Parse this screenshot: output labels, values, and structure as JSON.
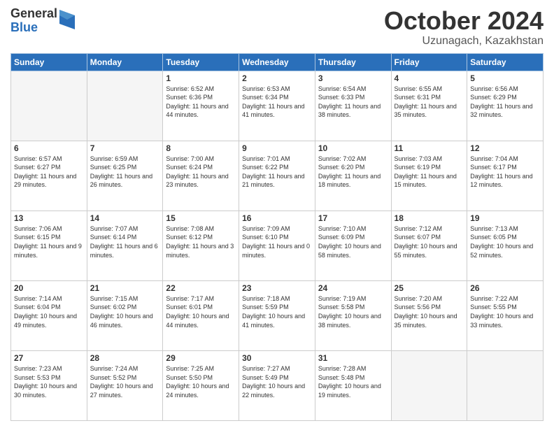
{
  "logo": {
    "general": "General",
    "blue": "Blue"
  },
  "header": {
    "month": "October 2024",
    "location": "Uzunagach, Kazakhstan"
  },
  "days_of_week": [
    "Sunday",
    "Monday",
    "Tuesday",
    "Wednesday",
    "Thursday",
    "Friday",
    "Saturday"
  ],
  "weeks": [
    [
      {
        "day": "",
        "info": ""
      },
      {
        "day": "",
        "info": ""
      },
      {
        "day": "1",
        "info": "Sunrise: 6:52 AM\nSunset: 6:36 PM\nDaylight: 11 hours and 44 minutes."
      },
      {
        "day": "2",
        "info": "Sunrise: 6:53 AM\nSunset: 6:34 PM\nDaylight: 11 hours and 41 minutes."
      },
      {
        "day": "3",
        "info": "Sunrise: 6:54 AM\nSunset: 6:33 PM\nDaylight: 11 hours and 38 minutes."
      },
      {
        "day": "4",
        "info": "Sunrise: 6:55 AM\nSunset: 6:31 PM\nDaylight: 11 hours and 35 minutes."
      },
      {
        "day": "5",
        "info": "Sunrise: 6:56 AM\nSunset: 6:29 PM\nDaylight: 11 hours and 32 minutes."
      }
    ],
    [
      {
        "day": "6",
        "info": "Sunrise: 6:57 AM\nSunset: 6:27 PM\nDaylight: 11 hours and 29 minutes."
      },
      {
        "day": "7",
        "info": "Sunrise: 6:59 AM\nSunset: 6:25 PM\nDaylight: 11 hours and 26 minutes."
      },
      {
        "day": "8",
        "info": "Sunrise: 7:00 AM\nSunset: 6:24 PM\nDaylight: 11 hours and 23 minutes."
      },
      {
        "day": "9",
        "info": "Sunrise: 7:01 AM\nSunset: 6:22 PM\nDaylight: 11 hours and 21 minutes."
      },
      {
        "day": "10",
        "info": "Sunrise: 7:02 AM\nSunset: 6:20 PM\nDaylight: 11 hours and 18 minutes."
      },
      {
        "day": "11",
        "info": "Sunrise: 7:03 AM\nSunset: 6:19 PM\nDaylight: 11 hours and 15 minutes."
      },
      {
        "day": "12",
        "info": "Sunrise: 7:04 AM\nSunset: 6:17 PM\nDaylight: 11 hours and 12 minutes."
      }
    ],
    [
      {
        "day": "13",
        "info": "Sunrise: 7:06 AM\nSunset: 6:15 PM\nDaylight: 11 hours and 9 minutes."
      },
      {
        "day": "14",
        "info": "Sunrise: 7:07 AM\nSunset: 6:14 PM\nDaylight: 11 hours and 6 minutes."
      },
      {
        "day": "15",
        "info": "Sunrise: 7:08 AM\nSunset: 6:12 PM\nDaylight: 11 hours and 3 minutes."
      },
      {
        "day": "16",
        "info": "Sunrise: 7:09 AM\nSunset: 6:10 PM\nDaylight: 11 hours and 0 minutes."
      },
      {
        "day": "17",
        "info": "Sunrise: 7:10 AM\nSunset: 6:09 PM\nDaylight: 10 hours and 58 minutes."
      },
      {
        "day": "18",
        "info": "Sunrise: 7:12 AM\nSunset: 6:07 PM\nDaylight: 10 hours and 55 minutes."
      },
      {
        "day": "19",
        "info": "Sunrise: 7:13 AM\nSunset: 6:05 PM\nDaylight: 10 hours and 52 minutes."
      }
    ],
    [
      {
        "day": "20",
        "info": "Sunrise: 7:14 AM\nSunset: 6:04 PM\nDaylight: 10 hours and 49 minutes."
      },
      {
        "day": "21",
        "info": "Sunrise: 7:15 AM\nSunset: 6:02 PM\nDaylight: 10 hours and 46 minutes."
      },
      {
        "day": "22",
        "info": "Sunrise: 7:17 AM\nSunset: 6:01 PM\nDaylight: 10 hours and 44 minutes."
      },
      {
        "day": "23",
        "info": "Sunrise: 7:18 AM\nSunset: 5:59 PM\nDaylight: 10 hours and 41 minutes."
      },
      {
        "day": "24",
        "info": "Sunrise: 7:19 AM\nSunset: 5:58 PM\nDaylight: 10 hours and 38 minutes."
      },
      {
        "day": "25",
        "info": "Sunrise: 7:20 AM\nSunset: 5:56 PM\nDaylight: 10 hours and 35 minutes."
      },
      {
        "day": "26",
        "info": "Sunrise: 7:22 AM\nSunset: 5:55 PM\nDaylight: 10 hours and 33 minutes."
      }
    ],
    [
      {
        "day": "27",
        "info": "Sunrise: 7:23 AM\nSunset: 5:53 PM\nDaylight: 10 hours and 30 minutes."
      },
      {
        "day": "28",
        "info": "Sunrise: 7:24 AM\nSunset: 5:52 PM\nDaylight: 10 hours and 27 minutes."
      },
      {
        "day": "29",
        "info": "Sunrise: 7:25 AM\nSunset: 5:50 PM\nDaylight: 10 hours and 24 minutes."
      },
      {
        "day": "30",
        "info": "Sunrise: 7:27 AM\nSunset: 5:49 PM\nDaylight: 10 hours and 22 minutes."
      },
      {
        "day": "31",
        "info": "Sunrise: 7:28 AM\nSunset: 5:48 PM\nDaylight: 10 hours and 19 minutes."
      },
      {
        "day": "",
        "info": ""
      },
      {
        "day": "",
        "info": ""
      }
    ]
  ]
}
